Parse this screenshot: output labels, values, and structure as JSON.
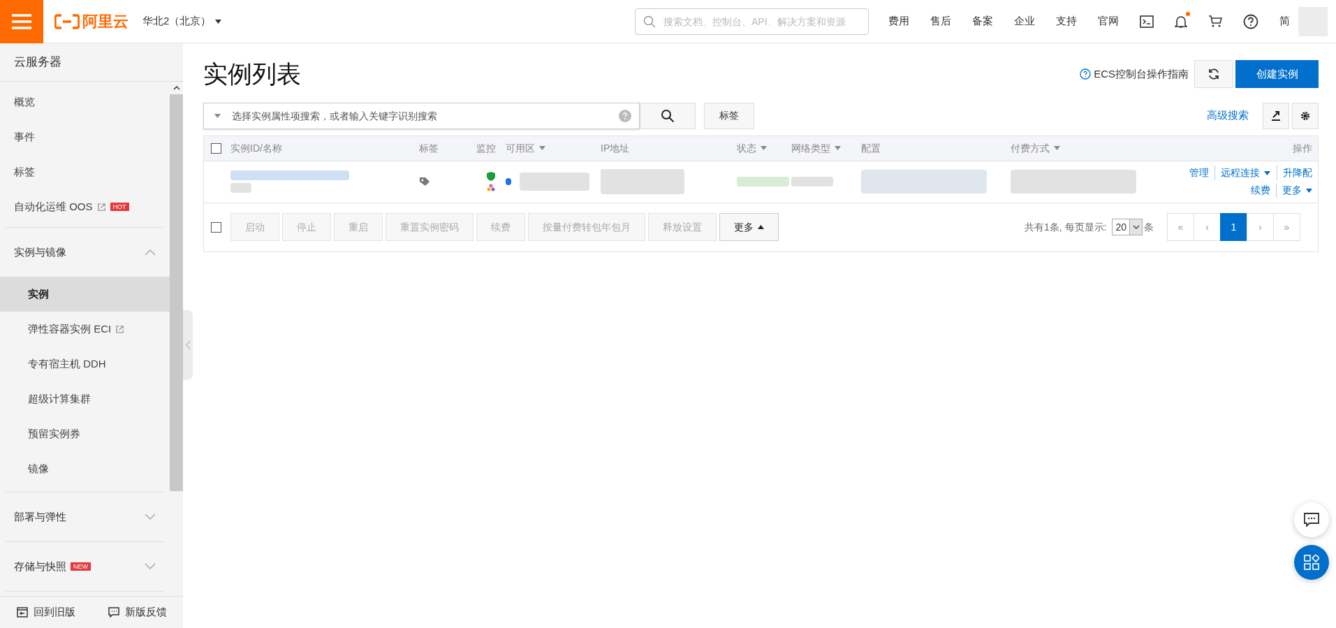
{
  "topbar": {
    "logo": "阿里云",
    "region": "华北2（北京）",
    "search": {
      "placeholder": "搜索文档、控制台、API、解决方案和资源"
    },
    "links": [
      "费用",
      "售后",
      "备案",
      "企业",
      "支持",
      "官网"
    ],
    "notification_dot": true,
    "language": "简"
  },
  "sidebar": {
    "title": "云服务器",
    "sections": [
      {
        "items": [
          {
            "label": "概览",
            "selected": false,
            "external": false
          },
          {
            "label": "事件",
            "selected": false,
            "external": false
          },
          {
            "label": "标签",
            "selected": false,
            "external": false
          },
          {
            "label": "自动化运维 OOS",
            "selected": false,
            "external": true,
            "badge": "HOT"
          }
        ]
      },
      {
        "header": "实例与镜像",
        "expanded": true,
        "items": [
          {
            "label": "实例",
            "selected": true,
            "external": false
          },
          {
            "label": "弹性容器实例 ECI",
            "selected": false,
            "external": true
          },
          {
            "label": "专有宿主机 DDH",
            "selected": false,
            "external": false
          },
          {
            "label": "超级计算集群",
            "selected": false,
            "external": false
          },
          {
            "label": "预留实例券",
            "selected": false,
            "external": false
          },
          {
            "label": "镜像",
            "selected": false,
            "external": false
          }
        ]
      },
      {
        "header": "部署与弹性",
        "expanded": false
      },
      {
        "header": "存储与快照",
        "expanded": false,
        "badge": "NEW"
      }
    ],
    "footer": [
      "回到旧版",
      "新版反馈"
    ]
  },
  "page": {
    "title": "实例列表",
    "guide_link": "ECS控制台操作指南",
    "create_button": "创建实例",
    "search": {
      "placeholder": "选择实例属性项搜索，或者输入关键字识别搜索"
    },
    "tag_button": "标签",
    "advanced_search": "高级搜索",
    "table": {
      "columns": [
        {
          "label": "实例ID/名称",
          "sortable": false
        },
        {
          "label": "标签",
          "sortable": false
        },
        {
          "label": "监控",
          "sortable": false
        },
        {
          "label": "可用区",
          "sortable": true
        },
        {
          "label": "IP地址",
          "sortable": false
        },
        {
          "label": "状态",
          "sortable": true
        },
        {
          "label": "网络类型",
          "sortable": true
        },
        {
          "label": "配置",
          "sortable": false
        },
        {
          "label": "付费方式",
          "sortable": true
        },
        {
          "label": "操作",
          "sortable": false
        }
      ],
      "rows": [
        {
          "actions": [
            {
              "label": "管理",
              "dropdown": false
            },
            {
              "label": "远程连接",
              "dropdown": true
            },
            {
              "label": "升降配",
              "dropdown": false
            },
            {
              "label": "续费",
              "dropdown": false
            },
            {
              "label": "更多",
              "dropdown": true
            }
          ]
        }
      ],
      "select_all_checked": false
    },
    "bulk_actions": [
      {
        "label": "启动",
        "disabled": true
      },
      {
        "label": "停止",
        "disabled": true
      },
      {
        "label": "重启",
        "disabled": true
      },
      {
        "label": "重置实例密码",
        "disabled": true
      },
      {
        "label": "续费",
        "disabled": true
      },
      {
        "label": "按量付费转包年包月",
        "disabled": true
      },
      {
        "label": "释放设置",
        "disabled": true
      },
      {
        "label": "更多",
        "disabled": false
      }
    ],
    "bulk_checked": false,
    "pagination": {
      "summary": "共有1条, 每页显示:",
      "page_size": "20",
      "unit": "条",
      "pages": [
        {
          "label": "«",
          "selected": false
        },
        {
          "label": "‹",
          "selected": false
        },
        {
          "label": "1",
          "selected": true
        },
        {
          "label": "›",
          "selected": false
        },
        {
          "label": "»",
          "selected": false
        }
      ]
    }
  }
}
